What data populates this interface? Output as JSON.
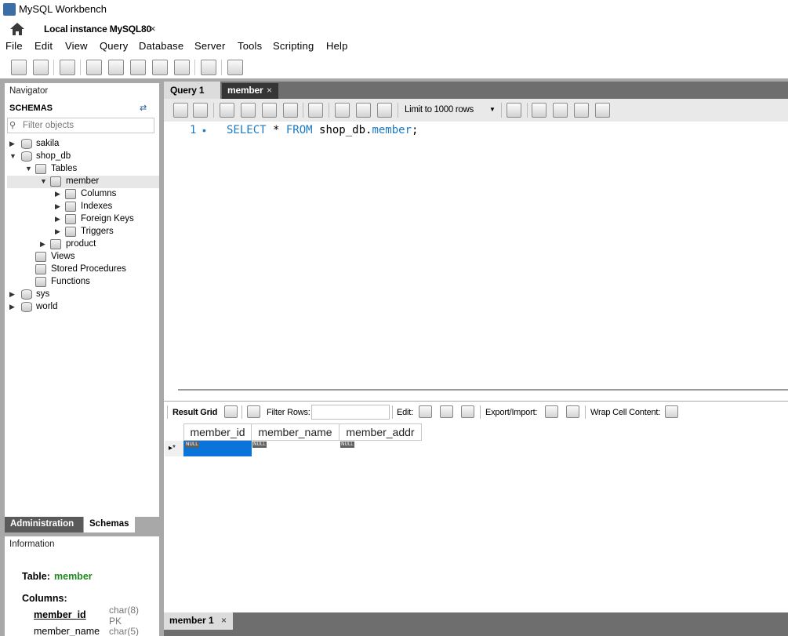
{
  "window": {
    "title": "MySQL Workbench"
  },
  "connection_tab": {
    "label": "Local instance MySQL80",
    "close": "×"
  },
  "menu": [
    "File",
    "Edit",
    "View",
    "Query",
    "Database",
    "Server",
    "Tools",
    "Scripting",
    "Help"
  ],
  "navigator": {
    "header": "Navigator",
    "schemas_label": "SCHEMAS",
    "filter_placeholder": "Filter objects",
    "tree": {
      "sakila": "sakila",
      "shop_db": "shop_db",
      "tables": "Tables",
      "member": "member",
      "columns": "Columns",
      "indexes": "Indexes",
      "foreign_keys": "Foreign Keys",
      "triggers": "Triggers",
      "product": "product",
      "views": "Views",
      "stored_procedures": "Stored Procedures",
      "functions": "Functions",
      "sys": "sys",
      "world": "world"
    }
  },
  "nav_tabs": {
    "administration": "Administration",
    "schemas": "Schemas"
  },
  "information": {
    "header": "Information",
    "table_label": "Table:",
    "table_name": "member",
    "columns_label": "Columns:",
    "columns": [
      {
        "name": "member_id",
        "type": "char(8)",
        "key": "PK"
      },
      {
        "name": "member_name",
        "type": "char(5)"
      }
    ]
  },
  "editor_tabs": {
    "query1": "Query 1",
    "member": "member",
    "close": "×"
  },
  "editor_toolbar": {
    "limit": "Limit to 1000 rows"
  },
  "editor": {
    "line_number": "1",
    "line_marker": "•",
    "sql": {
      "select": "SELECT",
      "star": " * ",
      "from": "FROM",
      "schema": " shop_db.",
      "table": "member",
      "end": ";"
    }
  },
  "result_toolbar": {
    "result_grid": "Result Grid",
    "filter_rows": "Filter Rows:",
    "edit": "Edit:",
    "export_import": "Export/Import:",
    "wrap": "Wrap Cell Content:"
  },
  "result_grid": {
    "columns": [
      "member_id",
      "member_name",
      "member_addr"
    ],
    "row_marker": "▸*",
    "null_label": "NULL"
  },
  "result_tab": {
    "label": "member 1",
    "close": "×"
  },
  "colors": {
    "accent": "#0a74da",
    "keyword": "#1a7ac4",
    "table_name": "#1e8a1e"
  }
}
